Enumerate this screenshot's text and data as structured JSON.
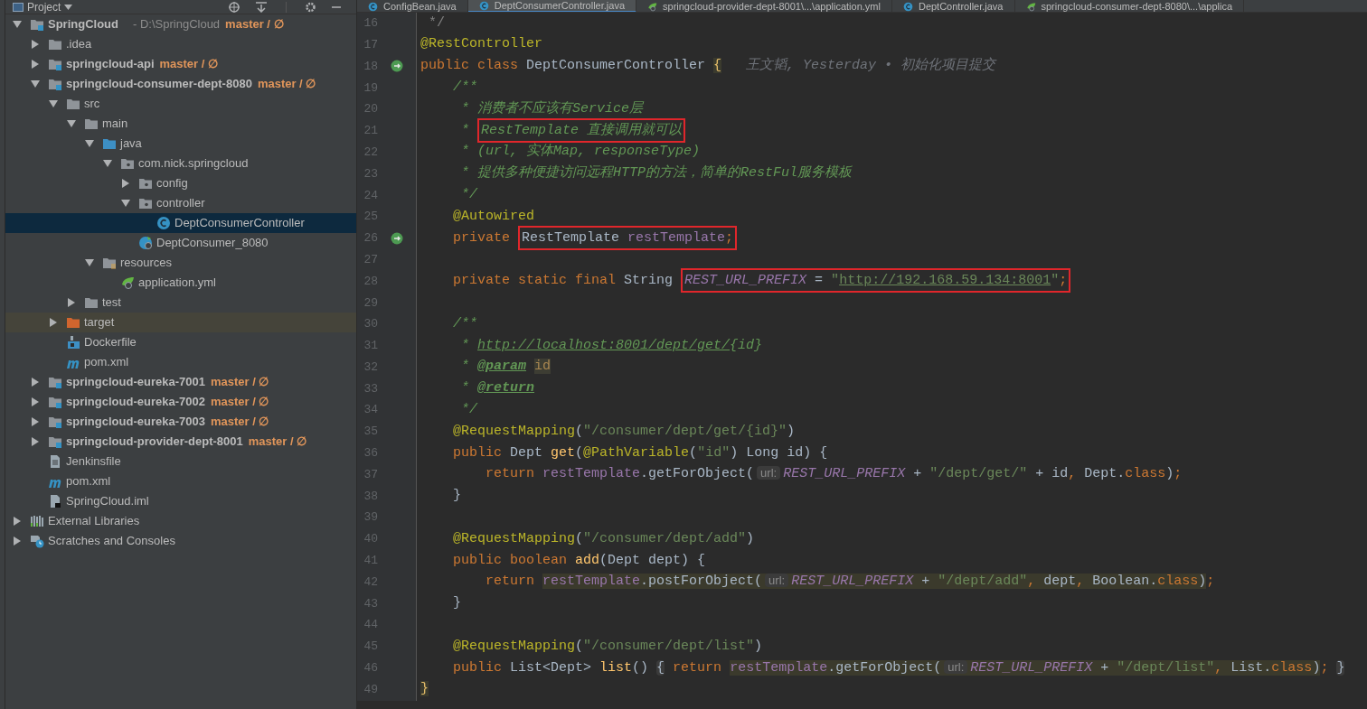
{
  "sidebar": {
    "title": "Project",
    "tree": [
      {
        "label": "SpringCloud",
        "kind": "module",
        "path": "- D:\\SpringCloud",
        "vcs": "master / ∅",
        "expanded": true,
        "selected": false,
        "children": [
          {
            "label": ".idea",
            "kind": "folder",
            "expanded": false,
            "selected": false
          },
          {
            "label": "springcloud-api",
            "kind": "module",
            "vcs": "master / ∅",
            "expanded": false,
            "selected": false
          },
          {
            "label": "springcloud-consumer-dept-8080",
            "kind": "module",
            "vcs": "master / ∅",
            "expanded": true,
            "selected": false,
            "children": [
              {
                "label": "src",
                "kind": "folder",
                "expanded": true,
                "selected": false,
                "children": [
                  {
                    "label": "main",
                    "kind": "folder",
                    "expanded": true,
                    "selected": false,
                    "children": [
                      {
                        "label": "java",
                        "kind": "source-folder",
                        "expanded": true,
                        "selected": false,
                        "children": [
                          {
                            "label": "com.nick.springcloud",
                            "kind": "package",
                            "expanded": true,
                            "selected": false,
                            "children": [
                              {
                                "label": "config",
                                "kind": "package",
                                "expanded": false,
                                "selected": false
                              },
                              {
                                "label": "controller",
                                "kind": "package",
                                "expanded": true,
                                "selected": false,
                                "children": [
                                  {
                                    "label": "DeptConsumerController",
                                    "kind": "class",
                                    "selected": true
                                  }
                                ]
                              },
                              {
                                "label": "DeptConsumer_8080",
                                "kind": "boot-class",
                                "selected": false
                              }
                            ]
                          }
                        ]
                      },
                      {
                        "label": "resources",
                        "kind": "resources-folder",
                        "expanded": true,
                        "selected": false,
                        "children": [
                          {
                            "label": "application.yml",
                            "kind": "yml",
                            "selected": false
                          }
                        ]
                      }
                    ]
                  },
                  {
                    "label": "test",
                    "kind": "folder",
                    "expanded": false,
                    "selected": false
                  }
                ]
              },
              {
                "label": "target",
                "kind": "excluded-folder",
                "expanded": false,
                "selected": false
              },
              {
                "label": "Dockerfile",
                "kind": "docker",
                "selected": false
              },
              {
                "label": "pom.xml",
                "kind": "maven",
                "selected": false
              }
            ]
          },
          {
            "label": "springcloud-eureka-7001",
            "kind": "module",
            "vcs": "master / ∅",
            "expanded": false,
            "selected": false
          },
          {
            "label": "springcloud-eureka-7002",
            "kind": "module",
            "vcs": "master / ∅",
            "expanded": false,
            "selected": false
          },
          {
            "label": "springcloud-eureka-7003",
            "kind": "module",
            "vcs": "master / ∅",
            "expanded": false,
            "selected": false
          },
          {
            "label": "springcloud-provider-dept-8001",
            "kind": "module",
            "vcs": "master / ∅",
            "expanded": false,
            "selected": false
          },
          {
            "label": "Jenkinsfile",
            "kind": "file",
            "selected": false
          },
          {
            "label": "pom.xml",
            "kind": "maven",
            "selected": false
          },
          {
            "label": "SpringCloud.iml",
            "kind": "iml",
            "selected": false
          }
        ]
      },
      {
        "label": "External Libraries",
        "kind": "libraries",
        "expanded": false,
        "selected": false
      },
      {
        "label": "Scratches and Consoles",
        "kind": "scratches",
        "expanded": false,
        "selected": false
      }
    ]
  },
  "tabs": [
    {
      "label": "ConfigBean.java",
      "kind": "class",
      "selected": false
    },
    {
      "label": "DeptConsumerController.java",
      "kind": "class",
      "selected": true
    },
    {
      "label": "springcloud-provider-dept-8001\\...\\application.yml",
      "kind": "yml",
      "selected": false
    },
    {
      "label": "DeptController.java",
      "kind": "class",
      "selected": false
    },
    {
      "label": "springcloud-consumer-dept-8080\\...\\applica",
      "kind": "yml",
      "selected": false
    }
  ],
  "editor": {
    "lines": [
      {
        "number": "16",
        "kind": "code",
        "tokens": [
          {
            "text": " */",
            "kind": "comment"
          }
        ]
      },
      {
        "number": "17",
        "kind": "code",
        "tokens": [
          {
            "text": "@RestController",
            "kind": "annotation"
          }
        ]
      },
      {
        "number": "18",
        "kind": "bean",
        "tokens": [
          {
            "text": "public class ",
            "kind": "keyword"
          },
          {
            "text": "DeptConsumerController ",
            "kind": "plain"
          },
          {
            "text": "{",
            "kind": "brace"
          },
          {
            "text": "   王文韬, Yesterday • 初始化项目提交",
            "kind": "blame"
          }
        ]
      },
      {
        "number": "19",
        "kind": "code",
        "tokens": [
          {
            "text": "    /**",
            "kind": "doc"
          }
        ]
      },
      {
        "number": "20",
        "kind": "code",
        "tokens": [
          {
            "text": "     * 消费者不应该有Service层",
            "kind": "doc"
          }
        ]
      },
      {
        "number": "21",
        "kind": "code",
        "tokens": [
          {
            "text": "     * ",
            "kind": "doc"
          },
          {
            "kind": "box",
            "tokens": [
              {
                "text": "RestTemplate 直接调用就可以",
                "kind": "doc"
              }
            ]
          }
        ]
      },
      {
        "number": "22",
        "kind": "code",
        "tokens": [
          {
            "text": "     * (url, 实体Map, responseType)",
            "kind": "doc"
          }
        ]
      },
      {
        "number": "23",
        "kind": "code",
        "tokens": [
          {
            "text": "     * 提供多种便捷访问远程HTTP的方法，简单的RestFul服务模板",
            "kind": "doc"
          }
        ]
      },
      {
        "number": "24",
        "kind": "code",
        "tokens": [
          {
            "text": "     */",
            "kind": "doc"
          }
        ]
      },
      {
        "number": "25",
        "kind": "code",
        "tokens": [
          {
            "text": "    @Autowired",
            "kind": "annotation"
          }
        ]
      },
      {
        "number": "26",
        "kind": "bean",
        "tokens": [
          {
            "text": "    private ",
            "kind": "keyword"
          },
          {
            "kind": "box",
            "tokens": [
              {
                "text": "RestTemplate ",
                "kind": "plain"
              },
              {
                "text": "restTemplate",
                "kind": "field"
              },
              {
                "text": ";",
                "kind": "keyword"
              }
            ]
          }
        ]
      },
      {
        "number": "27",
        "kind": "code"
      },
      {
        "number": "28",
        "kind": "code",
        "tokens": [
          {
            "text": "    private static final ",
            "kind": "keyword"
          },
          {
            "text": "String ",
            "kind": "plain"
          },
          {
            "kind": "box",
            "tokens": [
              {
                "text": "REST_URL_PREFIX",
                "kind": "static"
              },
              {
                "text": " = ",
                "kind": "plain"
              },
              {
                "text": "\"",
                "kind": "string"
              },
              {
                "text": "http://192.168.59.134:8001",
                "kind": "string-link"
              },
              {
                "text": "\"",
                "kind": "string"
              },
              {
                "text": ";",
                "kind": "keyword"
              }
            ]
          }
        ]
      },
      {
        "number": "29",
        "kind": "code"
      },
      {
        "number": "30",
        "kind": "code",
        "tokens": [
          {
            "text": "    /**",
            "kind": "doc"
          }
        ]
      },
      {
        "number": "31",
        "kind": "code",
        "tokens": [
          {
            "text": "     * ",
            "kind": "doc"
          },
          {
            "text": "http://localhost:8001/dept/get/",
            "kind": "doc-link"
          },
          {
            "text": "{id}",
            "kind": "doc"
          }
        ]
      },
      {
        "number": "32",
        "kind": "code",
        "tokens": [
          {
            "text": "     * ",
            "kind": "doc"
          },
          {
            "text": "@param",
            "kind": "doc-tag"
          },
          {
            "text": "id",
            "kind": "doc-param"
          }
        ]
      },
      {
        "number": "33",
        "kind": "code",
        "tokens": [
          {
            "text": "     * ",
            "kind": "doc"
          },
          {
            "text": "@return",
            "kind": "doc-tag"
          }
        ]
      },
      {
        "number": "34",
        "kind": "code",
        "tokens": [
          {
            "text": "     */",
            "kind": "doc"
          }
        ]
      },
      {
        "number": "35",
        "kind": "code",
        "tokens": [
          {
            "text": "    @RequestMapping",
            "kind": "annotation"
          },
          {
            "text": "(",
            "kind": "plain"
          },
          {
            "text": "\"/consumer/dept/get/{id}\"",
            "kind": "string"
          },
          {
            "text": ")",
            "kind": "plain"
          }
        ]
      },
      {
        "number": "36",
        "kind": "code",
        "tokens": [
          {
            "text": "    public ",
            "kind": "keyword"
          },
          {
            "text": "Dept ",
            "kind": "plain"
          },
          {
            "text": "get",
            "kind": "method"
          },
          {
            "text": "(",
            "kind": "plain"
          },
          {
            "text": "@PathVariable",
            "kind": "annotation"
          },
          {
            "text": "(",
            "kind": "plain"
          },
          {
            "text": "\"id\"",
            "kind": "string"
          },
          {
            "text": ") Long id) {",
            "kind": "plain"
          }
        ]
      },
      {
        "number": "37",
        "kind": "code",
        "tokens": [
          {
            "text": "        return ",
            "kind": "keyword"
          },
          {
            "text": "restTemplate",
            "kind": "field"
          },
          {
            "text": ".getForObject(",
            "kind": "plain"
          },
          {
            "text": "url:",
            "kind": "hint"
          },
          {
            "text": "REST_URL_PREFIX",
            "kind": "static"
          },
          {
            "text": " + ",
            "kind": "plain"
          },
          {
            "text": "\"/dept/get/\"",
            "kind": "string"
          },
          {
            "text": " + id",
            "kind": "plain"
          },
          {
            "text": ", ",
            "kind": "keyword"
          },
          {
            "text": "Dept.",
            "kind": "plain"
          },
          {
            "text": "class",
            "kind": "keyword"
          },
          {
            "text": ")",
            "kind": "plain"
          },
          {
            "text": ";",
            "kind": "keyword"
          }
        ]
      },
      {
        "number": "38",
        "kind": "code",
        "tokens": [
          {
            "text": "    }",
            "kind": "plain"
          }
        ]
      },
      {
        "number": "39",
        "kind": "code"
      },
      {
        "number": "40",
        "kind": "code",
        "tokens": [
          {
            "text": "    @RequestMapping",
            "kind": "annotation"
          },
          {
            "text": "(",
            "kind": "plain"
          },
          {
            "text": "\"/consumer/dept/add\"",
            "kind": "string"
          },
          {
            "text": ")",
            "kind": "plain"
          }
        ]
      },
      {
        "number": "41",
        "kind": "code",
        "tokens": [
          {
            "text": "    public boolean ",
            "kind": "keyword"
          },
          {
            "text": "add",
            "kind": "method"
          },
          {
            "text": "(Dept dept) {",
            "kind": "plain"
          }
        ]
      },
      {
        "number": "42",
        "kind": "code",
        "tokens": [
          {
            "text": "        return ",
            "kind": "keyword"
          },
          {
            "kind": "usage",
            "tokens": [
              {
                "text": "restTemplate",
                "kind": "field"
              },
              {
                "text": ".postForObject(",
                "kind": "plain"
              },
              {
                "text": "url:",
                "kind": "hint"
              },
              {
                "text": "REST_URL_PREFIX",
                "kind": "static"
              },
              {
                "text": " + ",
                "kind": "plain"
              },
              {
                "text": "\"/dept/add\"",
                "kind": "string"
              },
              {
                "text": ", ",
                "kind": "keyword"
              },
              {
                "text": "dept",
                "kind": "plain"
              },
              {
                "text": ", ",
                "kind": "keyword"
              },
              {
                "text": "Boolean.",
                "kind": "plain"
              },
              {
                "text": "class",
                "kind": "keyword"
              },
              {
                "text": ")",
                "kind": "plain"
              }
            ]
          },
          {
            "text": ";",
            "kind": "keyword"
          }
        ]
      },
      {
        "number": "43",
        "kind": "code",
        "tokens": [
          {
            "text": "    }",
            "kind": "plain"
          }
        ]
      },
      {
        "number": "44",
        "kind": "code"
      },
      {
        "number": "45",
        "kind": "code",
        "tokens": [
          {
            "text": "    @RequestMapping",
            "kind": "annotation"
          },
          {
            "text": "(",
            "kind": "plain"
          },
          {
            "text": "\"/consumer/dept/list\"",
            "kind": "string"
          },
          {
            "text": ")",
            "kind": "plain"
          }
        ]
      },
      {
        "number": "46",
        "kind": "code",
        "tokens": [
          {
            "text": "    public ",
            "kind": "keyword"
          },
          {
            "text": "List<Dept> ",
            "kind": "plain"
          },
          {
            "text": "list",
            "kind": "method"
          },
          {
            "text": "() ",
            "kind": "plain"
          },
          {
            "text": "{",
            "kind": "fold"
          },
          {
            "text": " return ",
            "kind": "keyword"
          },
          {
            "kind": "usage",
            "tokens": [
              {
                "text": "restTemplate",
                "kind": "field"
              },
              {
                "text": ".getForObject(",
                "kind": "plain"
              },
              {
                "text": "url:",
                "kind": "hint"
              },
              {
                "text": "REST_URL_PREFIX",
                "kind": "static"
              },
              {
                "text": " + ",
                "kind": "plain"
              },
              {
                "text": "\"/dept/list\"",
                "kind": "string"
              },
              {
                "text": ", ",
                "kind": "keyword"
              },
              {
                "text": "List.",
                "kind": "plain"
              },
              {
                "text": "class",
                "kind": "keyword"
              },
              {
                "text": ")",
                "kind": "plain"
              }
            ]
          },
          {
            "text": "; ",
            "kind": "keyword"
          },
          {
            "text": "}",
            "kind": "fold"
          }
        ]
      },
      {
        "number": "49",
        "kind": "code",
        "tokens": [
          {
            "text": "}",
            "kind": "brace"
          }
        ]
      }
    ]
  }
}
